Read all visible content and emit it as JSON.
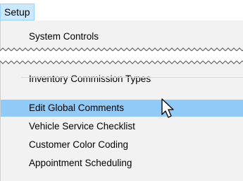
{
  "menu": {
    "title": "Setup"
  },
  "items": [
    {
      "label": "System Controls"
    },
    {
      "label": "Inventory Commission Types"
    },
    {
      "label": "Edit Global Comments"
    },
    {
      "label": "Vehicle Service Checklist"
    },
    {
      "label": "Customer Color Coding"
    },
    {
      "label": "Appointment Scheduling"
    }
  ],
  "hovered_item": "Edit Global Comments",
  "colors": {
    "menu_title_bg": "#cce8ff",
    "dropdown_bg": "#f2f2f2",
    "hover_bg": "#91c9f7"
  },
  "icons": {
    "cursor": "arrow-pointer-icon",
    "torn_edge": "torn-edge-break"
  }
}
